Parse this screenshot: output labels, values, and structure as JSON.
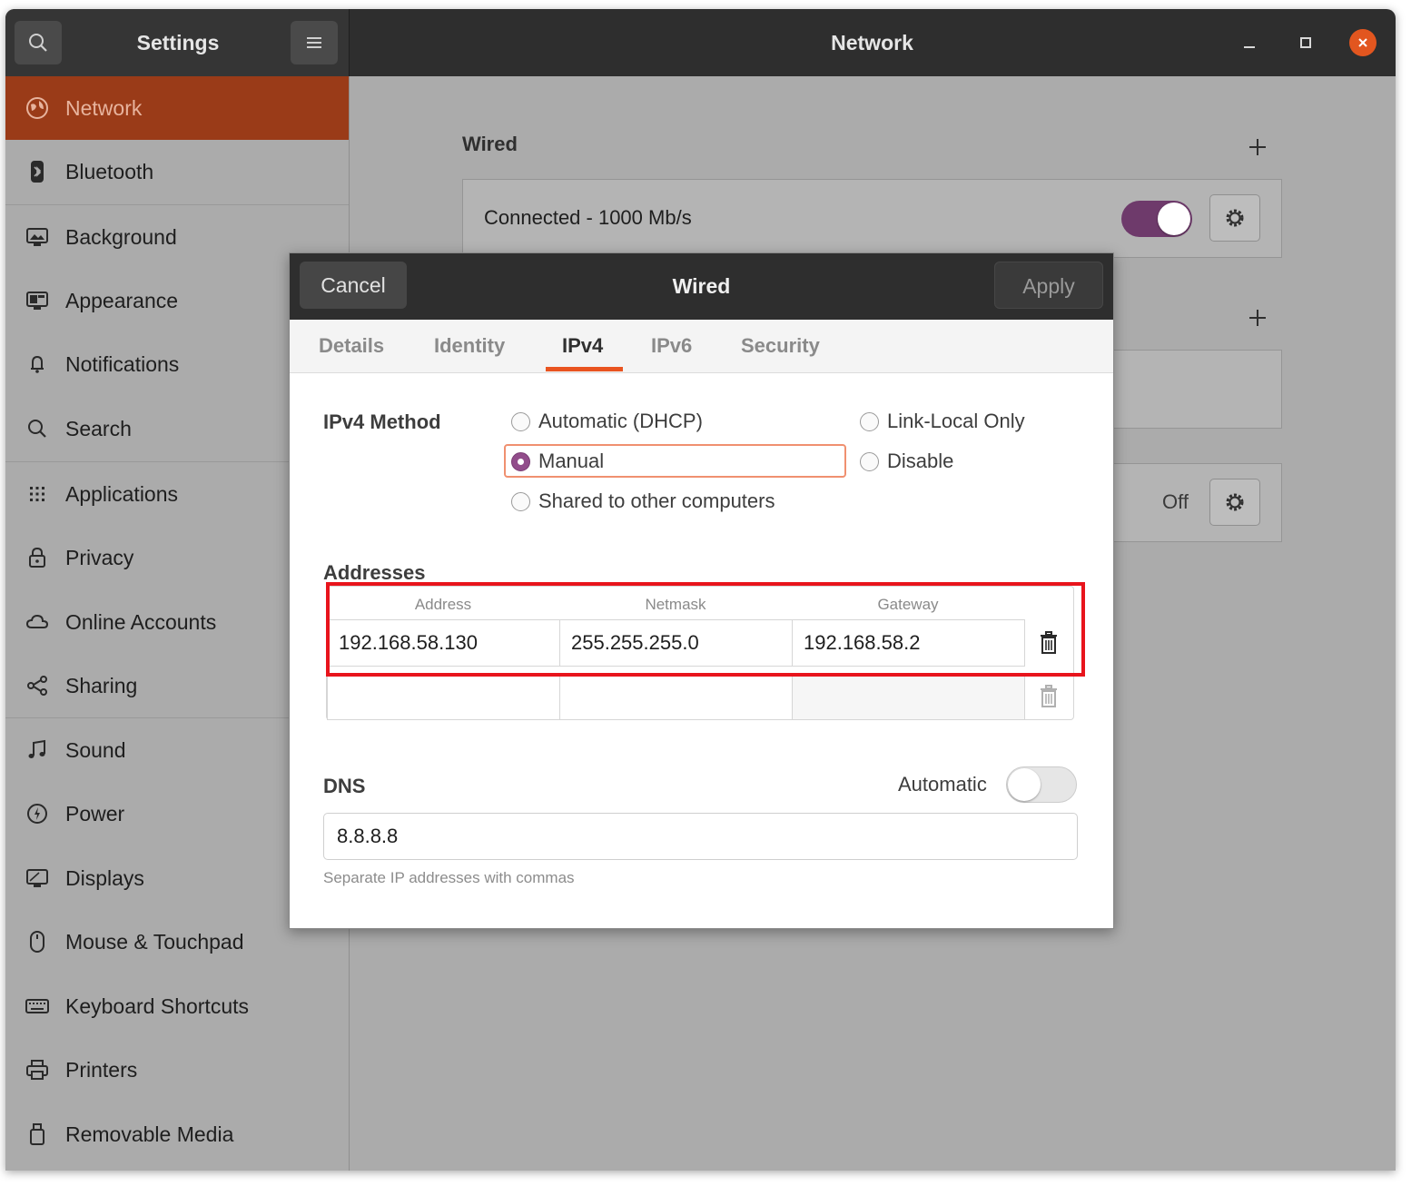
{
  "window": {
    "sidebar_title": "Settings",
    "title": "Network",
    "controls": [
      "minimize-icon",
      "maximize-icon",
      "close-icon"
    ]
  },
  "sidebar": {
    "items": [
      {
        "label": "Network",
        "icon": "network-icon",
        "active": true
      },
      {
        "label": "Bluetooth",
        "icon": "bluetooth-icon"
      },
      {
        "label": "Background",
        "icon": "background-icon"
      },
      {
        "label": "Appearance",
        "icon": "appearance-icon"
      },
      {
        "label": "Notifications",
        "icon": "bell-icon"
      },
      {
        "label": "Search",
        "icon": "search-icon"
      },
      {
        "label": "Applications",
        "icon": "grid-icon"
      },
      {
        "label": "Privacy",
        "icon": "lock-icon"
      },
      {
        "label": "Online Accounts",
        "icon": "cloud-icon"
      },
      {
        "label": "Sharing",
        "icon": "share-icon"
      },
      {
        "label": "Sound",
        "icon": "music-icon"
      },
      {
        "label": "Power",
        "icon": "power-icon"
      },
      {
        "label": "Displays",
        "icon": "display-icon"
      },
      {
        "label": "Mouse & Touchpad",
        "icon": "mouse-icon"
      },
      {
        "label": "Keyboard Shortcuts",
        "icon": "keyboard-icon"
      },
      {
        "label": "Printers",
        "icon": "printer-icon"
      },
      {
        "label": "Removable Media",
        "icon": "usb-icon"
      }
    ]
  },
  "main": {
    "wired_heading": "Wired",
    "wired_status": "Connected - 1000 Mb/s",
    "wired_toggle_on": true,
    "off_label": "Off"
  },
  "dialog": {
    "title": "Wired",
    "cancel": "Cancel",
    "apply": "Apply",
    "tabs": [
      "Details",
      "Identity",
      "IPv4",
      "IPv6",
      "Security"
    ],
    "active_tab": "IPv4",
    "method_label": "IPv4 Method",
    "methods": {
      "auto": "Automatic (DHCP)",
      "manual": "Manual",
      "shared": "Shared to other computers",
      "link_local": "Link-Local Only",
      "disable": "Disable"
    },
    "selected_method": "Manual",
    "addresses_label": "Addresses",
    "columns": [
      "Address",
      "Netmask",
      "Gateway"
    ],
    "rows": [
      {
        "address": "192.168.58.130",
        "netmask": "255.255.255.0",
        "gateway": "192.168.58.2"
      },
      {
        "address": "",
        "netmask": "",
        "gateway": ""
      }
    ],
    "dns_label": "DNS",
    "dns_automatic_label": "Automatic",
    "dns_automatic_on": false,
    "dns_value": "8.8.8.8",
    "dns_hint": "Separate IP addresses with commas"
  },
  "colors": {
    "accent": "#e95420",
    "active_item": "#9a3b18",
    "toggle_on": "#6e3a6b",
    "highlight_box": "#e8141c",
    "radio_selected": "#924d8b"
  }
}
